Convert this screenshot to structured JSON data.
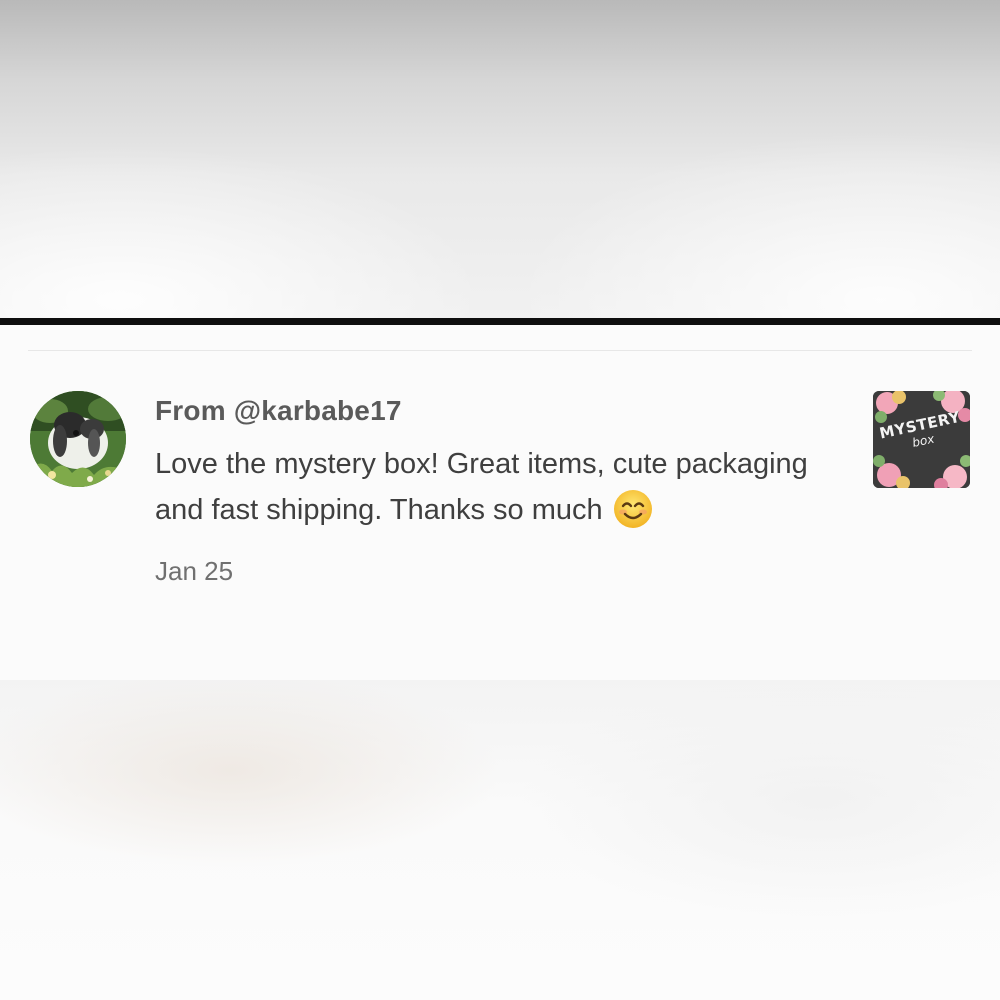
{
  "review": {
    "from": "From @karbabe17",
    "text": "Love the mystery box! Great items, cute packaging and fast shipping. Thanks so much",
    "emoji": "smiling-face-icon",
    "date": "Jan 25"
  },
  "thumbnail": {
    "line1": "MYSTERY",
    "line2": "box"
  },
  "colors": {
    "divider": "#0f0f0f",
    "card_background": "#fbfbfb",
    "username_text": "#5a5a5a",
    "body_text": "#3f3f3f",
    "date_text": "#707070"
  }
}
